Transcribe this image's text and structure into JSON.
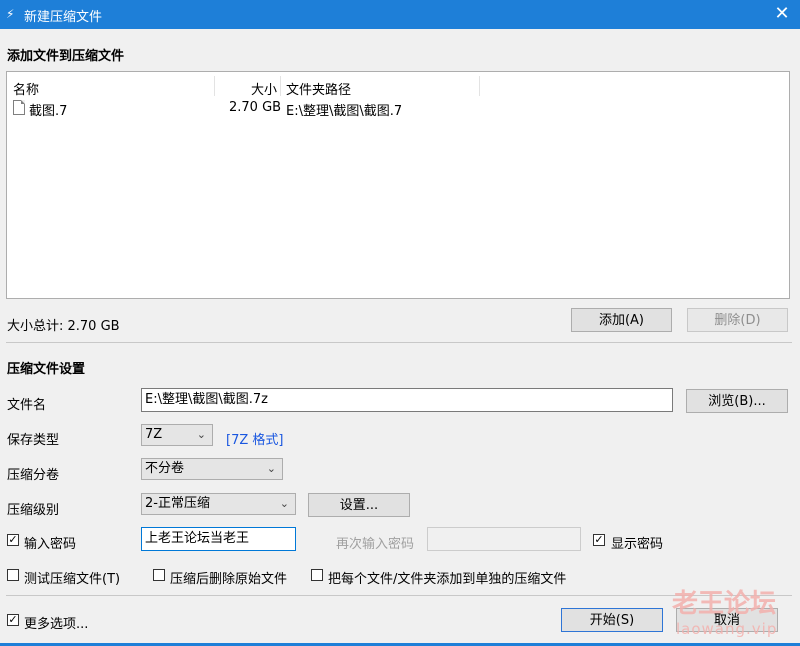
{
  "window": {
    "title": "新建压缩文件",
    "close_icon": "✕",
    "app_icon": "⚡"
  },
  "add_section": {
    "heading": "添加文件到压缩文件",
    "columns": {
      "name": "名称",
      "size": "大小",
      "path": "文件夹路径"
    },
    "files": [
      {
        "name": "截图.7",
        "size": "2.70 GB",
        "path": "E:\\整理\\截图\\截图.7"
      }
    ],
    "total": "大小总计: 2.70 GB",
    "add_button": "添加(A)",
    "delete_button": "删除(D)"
  },
  "settings": {
    "heading": "压缩文件设置",
    "filename_label": "文件名",
    "filename_value": "E:\\整理\\截图\\截图.7z",
    "browse_button": "浏览(B)...",
    "type_label": "保存类型",
    "type_value": "7Z",
    "type_link": "[7Z 格式]",
    "volume_label": "压缩分卷",
    "volume_value": "不分卷",
    "level_label": "压缩级别",
    "level_value": "2-正常压缩",
    "settings_button": "设置...",
    "password_label": "输入密码",
    "password_checked": true,
    "password_value": "上老王论坛当老王",
    "reenter_label": "再次输入密码",
    "reenter_value": "",
    "show_password_label": "显示密码",
    "show_password_checked": true,
    "test_label": "测试压缩文件(T)",
    "delete_after_label": "压缩后删除原始文件",
    "separate_label": "把每个文件/文件夹添加到单独的压缩文件"
  },
  "footer": {
    "more_options_label": "更多选项...",
    "more_options_checked": true,
    "start_button": "开始(S)",
    "cancel_button": "取消"
  },
  "watermark": {
    "line1": "老王论坛",
    "line2": "laowang.vip"
  },
  "colors": {
    "titlebar": "#1e7fd8",
    "link": "#1a57e0"
  }
}
